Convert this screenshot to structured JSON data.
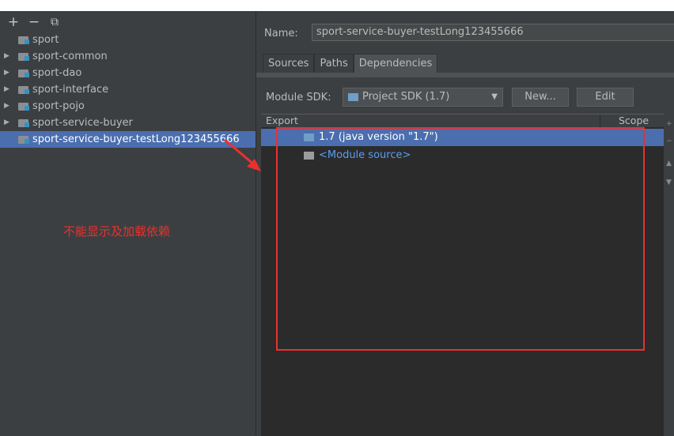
{
  "toolbar": {
    "add": "+",
    "remove": "−",
    "copy": "⧉"
  },
  "tree": [
    {
      "label": "sport",
      "expandable": false
    },
    {
      "label": "sport-common",
      "expandable": true
    },
    {
      "label": "sport-dao",
      "expandable": true
    },
    {
      "label": "sport-interface",
      "expandable": true
    },
    {
      "label": "sport-pojo",
      "expandable": true
    },
    {
      "label": "sport-service-buyer",
      "expandable": true
    },
    {
      "label": "sport-service-buyer-testLong123455666",
      "expandable": false,
      "selected": true
    }
  ],
  "name": {
    "label": "Name:",
    "value": "sport-service-buyer-testLong123455666"
  },
  "tabs": [
    "Sources",
    "Paths",
    "Dependencies"
  ],
  "active_tab": "Dependencies",
  "sdk": {
    "label": "Module SDK:",
    "value": "Project SDK (1.7)",
    "new_label": "New...",
    "edit_label": "Edit"
  },
  "table": {
    "headers": {
      "export": "Export",
      "scope": "Scope"
    },
    "rows": [
      {
        "label": "1.7 (java version \"1.7\")",
        "icon": "sdk-folder-icon",
        "selected": true
      },
      {
        "label": "<Module source>",
        "icon": "folder-icon",
        "selected": false
      }
    ]
  },
  "annotation": {
    "note": "不能显示及加载依赖",
    "color": "#e8312f"
  },
  "colors": {
    "background": "#3c3f41",
    "selection": "#4b6eaf",
    "table_bg": "#2b2b2b",
    "link": "#589df6"
  }
}
